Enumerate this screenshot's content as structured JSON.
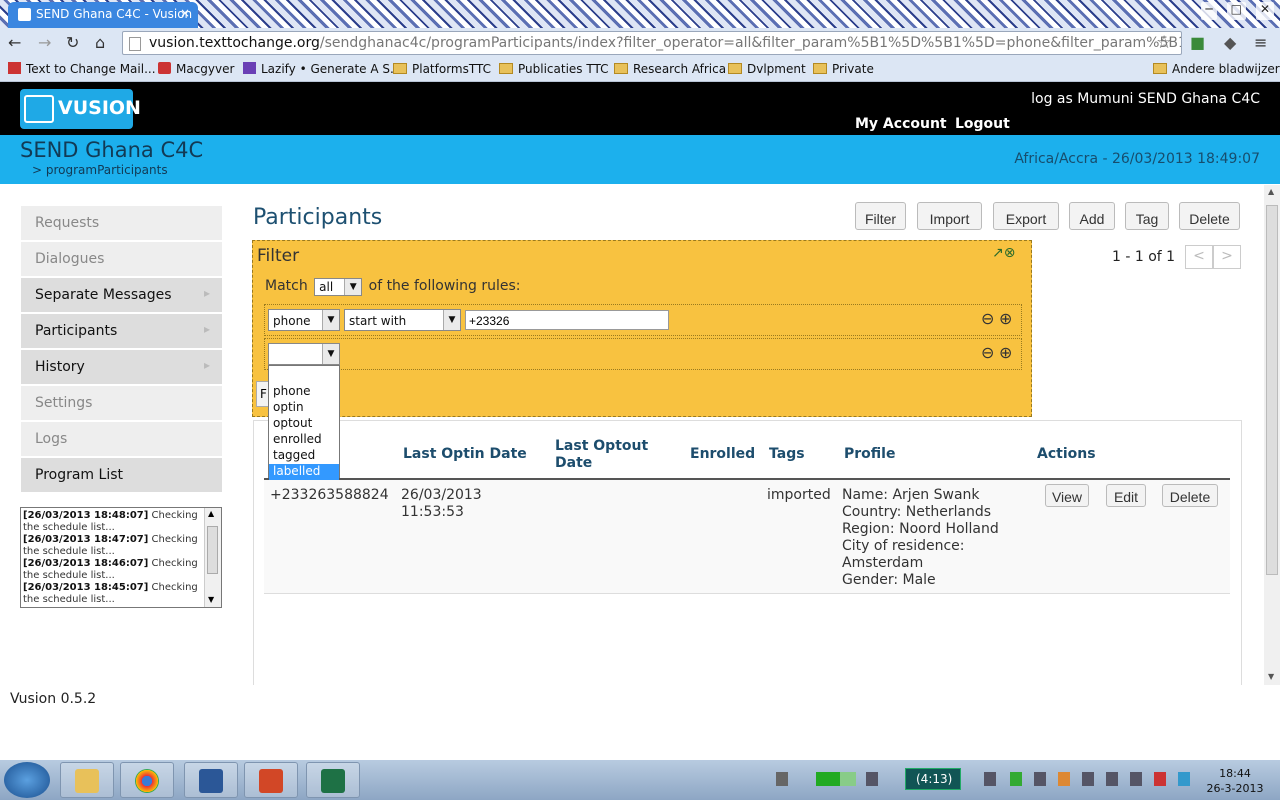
{
  "browser": {
    "tab_title": "SEND Ghana C4C - Vusion",
    "tab_close": "×",
    "url_host": "vusion.texttochange.org",
    "url_path": "/sendghanac4c/programParticipants/index?filter_operator=all&filter_param%5B1%5D%5B1%5D=phone&filter_param%5B1%",
    "bookmarks": [
      "Text to Change Mail...",
      "Macgyver",
      "Lazify • Generate A S...",
      "PlatformsTTC",
      "Publicaties TTC",
      "Research Africa",
      "Dvlpment",
      "Private"
    ],
    "other_bookmarks": "Andere bladwijzers"
  },
  "app": {
    "logo": "VUSION",
    "log_as": "log as Mumuni SEND Ghana C4C",
    "my_account": "My Account",
    "logout": "Logout",
    "program_name": "SEND Ghana C4C",
    "breadcrumb": "> programParticipants",
    "timezone_time": "Africa/Accra - 26/03/2013 18:49:07",
    "version": "Vusion 0.5.2"
  },
  "sidebar": {
    "items": [
      {
        "label": "Requests"
      },
      {
        "label": "Dialogues"
      },
      {
        "label": "Separate Messages"
      },
      {
        "label": "Participants"
      },
      {
        "label": "History"
      },
      {
        "label": "Settings"
      },
      {
        "label": "Logs"
      },
      {
        "label": "Program List"
      }
    ],
    "log_entries": [
      {
        "time": "[26/03/2013 18:48:07]",
        "text": " Checking the schedule list..."
      },
      {
        "time": "[26/03/2013 18:47:07]",
        "text": " Checking the schedule list..."
      },
      {
        "time": "[26/03/2013 18:46:07]",
        "text": " Checking the schedule list..."
      },
      {
        "time": "[26/03/2013 18:45:07]",
        "text": " Checking the schedule list..."
      }
    ]
  },
  "main": {
    "title": "Participants",
    "buttons": {
      "filter": "Filter",
      "import": "Import",
      "export": "Export",
      "add": "Add",
      "tag": "Tag",
      "delete": "Delete"
    },
    "pager": "1 - 1 of 1",
    "pager_prev": "<",
    "pager_next": ">"
  },
  "filter": {
    "title": "Filter",
    "match_label": "Match",
    "match_value": "all",
    "match_suffix": "of the following rules:",
    "rule1_field": "phone",
    "rule1_operator": "start with",
    "rule1_value": "+23326",
    "rule2_field": "",
    "dropdown_options": [
      "phone",
      "optin",
      "optout",
      "enrolled",
      "tagged",
      "labelled"
    ],
    "dropdown_highlight": "labelled"
  },
  "table": {
    "headers": {
      "last_optin": "Last Optin Date",
      "last_optout": "Last Optout Date",
      "enrolled": "Enrolled",
      "tags": "Tags",
      "profile": "Profile",
      "actions": "Actions"
    },
    "rows": [
      {
        "phone": "+233263588824",
        "last_optin_date": "26/03/2013",
        "last_optin_time": "11:53:53",
        "last_optout": "",
        "enrolled": "",
        "tags": "imported",
        "profile": [
          "Name: Arjen Swank",
          "Country: Netherlands",
          "Region: Noord Holland",
          "City of residence:",
          "Amsterdam",
          "Gender: Male"
        ],
        "actions": {
          "view": "View",
          "edit": "Edit",
          "delete": "Delete"
        }
      }
    ]
  },
  "taskbar": {
    "battery": "(4:13)",
    "time": "18:44",
    "date": "26-3-2013"
  },
  "colors": {
    "header_bg": "#000000",
    "subheader_bg": "#1cb0ed",
    "filter_bg": "#f8c240",
    "accent": "#1d5071"
  }
}
